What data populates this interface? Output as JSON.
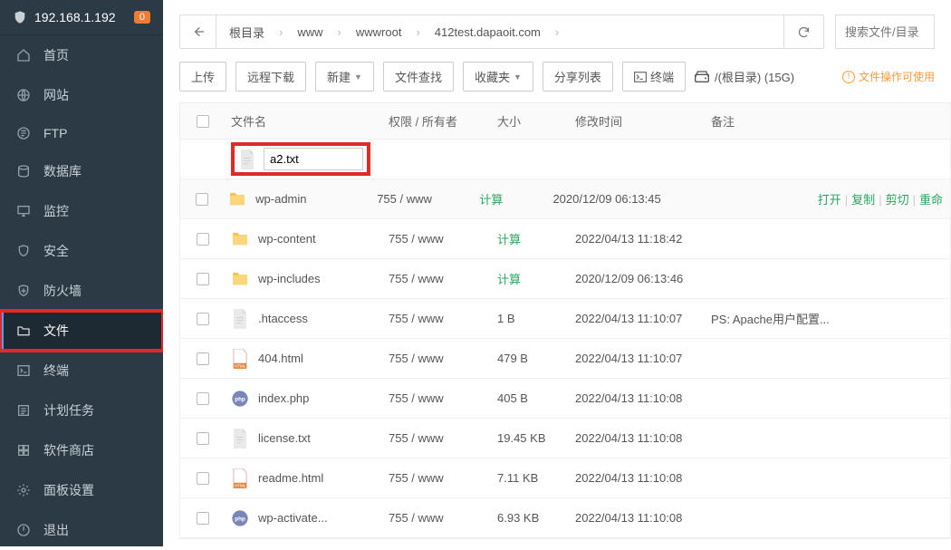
{
  "ip": "192.168.1.192",
  "badge": "0",
  "sidebar": [
    {
      "icon": "home",
      "label": "首页"
    },
    {
      "icon": "globe",
      "label": "网站"
    },
    {
      "icon": "ftp",
      "label": "FTP"
    },
    {
      "icon": "db",
      "label": "数据库"
    },
    {
      "icon": "monitor",
      "label": "监控"
    },
    {
      "icon": "shield",
      "label": "安全"
    },
    {
      "icon": "firewall",
      "label": "防火墙"
    },
    {
      "icon": "folder",
      "label": "文件",
      "active": true
    },
    {
      "icon": "terminal",
      "label": "终端"
    },
    {
      "icon": "tasks",
      "label": "计划任务"
    },
    {
      "icon": "store",
      "label": "软件商店"
    },
    {
      "icon": "gear",
      "label": "面板设置"
    },
    {
      "icon": "exit",
      "label": "退出"
    }
  ],
  "crumbs": [
    "根目录",
    "www",
    "wwwroot",
    "412test.dapaoit.com"
  ],
  "search_placeholder": "搜索文件/目录",
  "toolbar": {
    "upload": "上传",
    "remote": "远程下载",
    "new": "新建",
    "find": "文件查找",
    "fav": "收藏夹",
    "share": "分享列表",
    "term": "终端",
    "disk": "/(根目录) (15G)",
    "tip": "文件操作可使用"
  },
  "thead": {
    "name": "文件名",
    "perm": "权限 / 所有者",
    "size": "大小",
    "mtime": "修改时间",
    "note": "备注"
  },
  "edit_value": "a2.txt",
  "rows": [
    {
      "icon": "folder",
      "name": "wp-admin",
      "perm": "755 / www",
      "size": "计算",
      "calc": true,
      "mtime": "2020/12/09 06:13:45",
      "note": "",
      "ops": true
    },
    {
      "icon": "folder",
      "name": "wp-content",
      "perm": "755 / www",
      "size": "计算",
      "calc": true,
      "mtime": "2022/04/13 11:18:42",
      "note": ""
    },
    {
      "icon": "folder",
      "name": "wp-includes",
      "perm": "755 / www",
      "size": "计算",
      "calc": true,
      "mtime": "2020/12/09 06:13:46",
      "note": ""
    },
    {
      "icon": "txt",
      "name": ".htaccess",
      "perm": "755 / www",
      "size": "1 B",
      "mtime": "2022/04/13 11:10:07",
      "note": "PS: Apache用户配置..."
    },
    {
      "icon": "html",
      "name": "404.html",
      "perm": "755 / www",
      "size": "479 B",
      "mtime": "2022/04/13 11:10:07",
      "note": ""
    },
    {
      "icon": "php",
      "name": "index.php",
      "perm": "755 / www",
      "size": "405 B",
      "mtime": "2022/04/13 11:10:08",
      "note": ""
    },
    {
      "icon": "txt",
      "name": "license.txt",
      "perm": "755 / www",
      "size": "19.45 KB",
      "mtime": "2022/04/13 11:10:08",
      "note": ""
    },
    {
      "icon": "html",
      "name": "readme.html",
      "perm": "755 / www",
      "size": "7.11 KB",
      "mtime": "2022/04/13 11:10:08",
      "note": ""
    },
    {
      "icon": "php",
      "name": "wp-activate...",
      "perm": "755 / www",
      "size": "6.93 KB",
      "mtime": "2022/04/13 11:10:08",
      "note": ""
    }
  ],
  "ops": {
    "open": "打开",
    "copy": "复制",
    "cut": "剪切",
    "rename": "重命"
  }
}
